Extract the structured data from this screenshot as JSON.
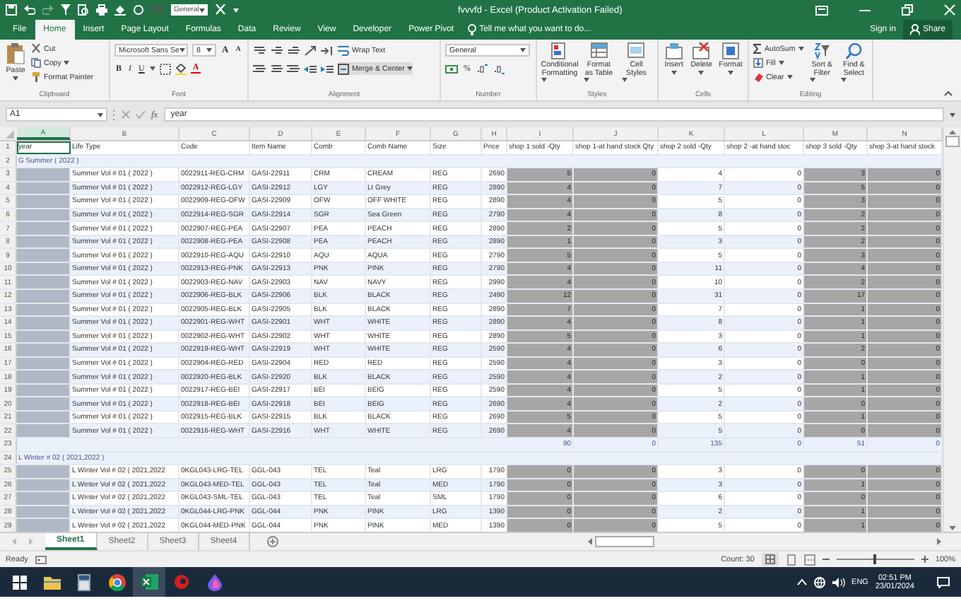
{
  "titlebar": {
    "quick_format": "General",
    "title": "fvvvfd - Excel (Product Activation Failed)"
  },
  "tabs": [
    {
      "label": "File",
      "selected": false
    },
    {
      "label": "Home",
      "selected": true
    },
    {
      "label": "Insert",
      "selected": false
    },
    {
      "label": "Page Layout",
      "selected": false
    },
    {
      "label": "Formulas",
      "selected": false
    },
    {
      "label": "Data",
      "selected": false
    },
    {
      "label": "Review",
      "selected": false
    },
    {
      "label": "View",
      "selected": false
    },
    {
      "label": "Developer",
      "selected": false
    },
    {
      "label": "Power Pivot",
      "selected": false
    }
  ],
  "tell_me": "Tell me what you want to do...",
  "sign_in": "Sign in",
  "share": "Share",
  "ribbon": {
    "clipboard": {
      "paste": "Paste",
      "cut": "Cut",
      "copy": "Copy",
      "format_painter": "Format Painter",
      "label": "Clipboard"
    },
    "font": {
      "family": "Microsoft Sans Se",
      "size": "8",
      "grow": "A",
      "shrink": "A",
      "bold": "B",
      "italic": "I",
      "underline": "U",
      "font_color": "A",
      "label": "Font"
    },
    "alignment": {
      "wrap_text": "Wrap Text",
      "merge_center": "Merge & Center",
      "label": "Alignment"
    },
    "number": {
      "format": "General",
      "percent": "%",
      "label": "Number"
    },
    "styles": {
      "buttons": [
        "Conditional Formatting",
        "Format as Table",
        "Cell Styles"
      ],
      "label": "Styles"
    },
    "cells": {
      "buttons": [
        "Insert",
        "Delete",
        "Format"
      ],
      "label": "Cells"
    },
    "editing": {
      "autosum": "AutoSum",
      "fill": "Fill",
      "clear": "Clear",
      "sort": "Sort & Filter",
      "find": "Find & Select",
      "label": "Editing"
    }
  },
  "formula_bar": {
    "name_box": "A1",
    "fx": "fx",
    "content": "year"
  },
  "sheet": {
    "columns": [
      {
        "letter": "A",
        "selected": true,
        "shaded": false
      },
      {
        "letter": "B",
        "selected": false,
        "shaded": false
      },
      {
        "letter": "C",
        "selected": false,
        "shaded": false
      },
      {
        "letter": "D",
        "selected": false,
        "shaded": false
      },
      {
        "letter": "E",
        "selected": false,
        "shaded": false
      },
      {
        "letter": "F",
        "selected": false,
        "shaded": false
      },
      {
        "letter": "G",
        "selected": false,
        "shaded": false
      },
      {
        "letter": "H",
        "selected": false,
        "shaded": false
      },
      {
        "letter": "I",
        "selected": false,
        "shaded": true
      },
      {
        "letter": "J",
        "selected": false,
        "shaded": true
      },
      {
        "letter": "K",
        "selected": false,
        "shaded": false
      },
      {
        "letter": "L",
        "selected": false,
        "shaded": false
      },
      {
        "letter": "M",
        "selected": false,
        "shaded": true
      },
      {
        "letter": "N",
        "selected": false,
        "shaded": true
      }
    ],
    "rows": [
      {
        "number": "1",
        "kind": "header",
        "cells": [
          "year",
          "Life Type",
          "Code",
          "Item Name",
          "Comb",
          "Comb Name",
          "Size",
          "Price",
          "shop 1 sold -Qty",
          "shop 1-at hand stock Qty",
          "shop 2 sold -Qty",
          "shop 2 -at hand stoc",
          "shop 3 sold -Qty",
          "shop 3-at hand stock"
        ]
      },
      {
        "number": "2",
        "kind": "group",
        "title": "G Summer ( 2022 )"
      },
      {
        "number": "3",
        "kind": "data",
        "cells": [
          "Summer Vol # 01 ( 2022 )",
          "0022911-REG-CRM",
          "GASI-22911",
          "CRM",
          "CREAM",
          "REG",
          "2690",
          "5",
          "0",
          "4",
          "0",
          "3",
          "0"
        ]
      },
      {
        "number": "4",
        "kind": "data",
        "cells": [
          "Summer Vol # 01 ( 2022 )",
          "0022912-REG-LGY",
          "GASI-22912",
          "LGY",
          "Lt Grey",
          "REG",
          "2890",
          "4",
          "0",
          "7",
          "0",
          "5",
          "0"
        ]
      },
      {
        "number": "5",
        "kind": "data",
        "cells": [
          "Summer Vol # 01 ( 2022 )",
          "0022909-REG-OFW",
          "GASI-22909",
          "OFW",
          "OFF WHITE",
          "REG",
          "2890",
          "4",
          "0",
          "5",
          "0",
          "3",
          "0"
        ]
      },
      {
        "number": "6",
        "kind": "data",
        "cells": [
          "Summer Vol # 01 ( 2022 )",
          "0022914-REG-SGR",
          "GASI-22914",
          "SGR",
          "Sea Green",
          "REG",
          "2790",
          "4",
          "0",
          "8",
          "0",
          "2",
          "0"
        ]
      },
      {
        "number": "7",
        "kind": "data",
        "cells": [
          "Summer Vol # 01 ( 2022 )",
          "0022907-REG-PEA",
          "GASI-22907",
          "PEA",
          "PEACH",
          "REG",
          "2890",
          "2",
          "0",
          "5",
          "0",
          "2",
          "0"
        ]
      },
      {
        "number": "8",
        "kind": "data",
        "cells": [
          "Summer Vol # 01 ( 2022 )",
          "0022908-REG-PEA",
          "GASI-22908",
          "PEA",
          "PEACH",
          "REG",
          "2890",
          "1",
          "0",
          "3",
          "0",
          "2",
          "0"
        ]
      },
      {
        "number": "9",
        "kind": "data",
        "cells": [
          "Summer Vol # 01 ( 2022 )",
          "0022910-REG-AQU",
          "GASI-22910",
          "AQU",
          "AQUA",
          "REG",
          "2790",
          "5",
          "0",
          "5",
          "0",
          "3",
          "0"
        ]
      },
      {
        "number": "10",
        "kind": "data",
        "cells": [
          "Summer Vol # 01 ( 2022 )",
          "0022913-REG-PNK",
          "GASI-22913",
          "PNK",
          "PINK",
          "REG",
          "2790",
          "4",
          "0",
          "11",
          "0",
          "4",
          "0"
        ]
      },
      {
        "number": "11",
        "kind": "data",
        "cells": [
          "Summer Vol # 01 ( 2022 )",
          "0022903-REG-NAV",
          "GASI-22903",
          "NAV",
          "NAVY",
          "REG",
          "2990",
          "4",
          "0",
          "10",
          "0",
          "2",
          "0"
        ]
      },
      {
        "number": "12",
        "kind": "data",
        "cells": [
          "Summer Vol # 01 ( 2022 )",
          "0022906-REG-BLK",
          "GASI-22906",
          "BLK",
          "BLACK",
          "REG",
          "2490",
          "12",
          "0",
          "31",
          "0",
          "17",
          "0"
        ]
      },
      {
        "number": "13",
        "kind": "data",
        "cells": [
          "Summer Vol # 01 ( 2022 )",
          "0022905-REG-BLK",
          "GASI-22905",
          "BLK",
          "BLACK",
          "REG",
          "2890",
          "7",
          "0",
          "7",
          "0",
          "1",
          "0"
        ]
      },
      {
        "number": "14",
        "kind": "data",
        "cells": [
          "Summer Vol # 01 ( 2022 )",
          "0022901-REG-WHT",
          "GASI-22901",
          "WHT",
          "WHITE",
          "REG",
          "2890",
          "4",
          "0",
          "8",
          "0",
          "1",
          "0"
        ]
      },
      {
        "number": "15",
        "kind": "data",
        "cells": [
          "Summer Vol # 01 ( 2022 )",
          "0022902-REG-WHT",
          "GASI-22902",
          "WHT",
          "WHITE",
          "REG",
          "2890",
          "5",
          "0",
          "3",
          "0",
          "1",
          "0"
        ]
      },
      {
        "number": "16",
        "kind": "data",
        "cells": [
          "Summer Vol # 01 ( 2022 )",
          "0022919-REG-WHT",
          "GASI-22919",
          "WHT",
          "WHITE",
          "REG",
          "2590",
          "4",
          "0",
          "6",
          "0",
          "2",
          "0"
        ]
      },
      {
        "number": "17",
        "kind": "data",
        "cells": [
          "Summer Vol # 01 ( 2022 )",
          "0022904-REG-RED",
          "GASI-22904",
          "RED",
          "RED",
          "REG",
          "2590",
          "4",
          "0",
          "3",
          "0",
          "0",
          "0"
        ]
      },
      {
        "number": "18",
        "kind": "data",
        "cells": [
          "Summer Vol # 01 ( 2022 )",
          "0022920-REG-BLK",
          "GASI-22920",
          "BLK",
          "BLACK",
          "REG",
          "2590",
          "4",
          "0",
          "2",
          "0",
          "1",
          "0"
        ]
      },
      {
        "number": "19",
        "kind": "data",
        "cells": [
          "Summer Vol # 01 ( 2022 )",
          "0022917-REG-BEI",
          "GASI-22917",
          "BEI",
          "BEIG",
          "REG",
          "2590",
          "4",
          "0",
          "5",
          "0",
          "1",
          "0"
        ]
      },
      {
        "number": "20",
        "kind": "data",
        "cells": [
          "Summer Vol # 01 ( 2022 )",
          "0022918-REG-BEI",
          "GASI-22918",
          "BEI",
          "BEIG",
          "REG",
          "2690",
          "4",
          "0",
          "2",
          "0",
          "0",
          "0"
        ]
      },
      {
        "number": "21",
        "kind": "data",
        "cells": [
          "Summer Vol # 01 ( 2022 )",
          "0022915-REG-BLK",
          "GASI-22915",
          "BLK",
          "BLACK",
          "REG",
          "2690",
          "5",
          "0",
          "5",
          "0",
          "1",
          "0"
        ]
      },
      {
        "number": "22",
        "kind": "data",
        "cells": [
          "Summer Vol # 01 ( 2022 )",
          "0022916-REG-WHT",
          "GASI-22916",
          "WHT",
          "WHITE",
          "REG",
          "2690",
          "4",
          "0",
          "5",
          "0",
          "0",
          "0"
        ]
      },
      {
        "number": "23",
        "kind": "total",
        "totals": [
          "90",
          "0",
          "135",
          "0",
          "51",
          "0"
        ]
      },
      {
        "number": "24",
        "kind": "group",
        "title": "L Winter # 02 ( 2021,2022 )"
      },
      {
        "number": "25",
        "kind": "data",
        "cells": [
          "L Winter Vol # 02 ( 2021,2022",
          "0KGL043-LRG-TEL",
          "GGL-043",
          "TEL",
          "Teal",
          "LRG",
          "1790",
          "0",
          "0",
          "3",
          "0",
          "0",
          "0"
        ]
      },
      {
        "number": "26",
        "kind": "data",
        "cells": [
          "L Winter Vol # 02 ( 2021,2022",
          "0KGL043-MED-TEL",
          "GGL-043",
          "TEL",
          "Teal",
          "MED",
          "1790",
          "0",
          "0",
          "3",
          "0",
          "1",
          "0"
        ]
      },
      {
        "number": "27",
        "kind": "data",
        "cells": [
          "L Winter Vol # 02 ( 2021,2022",
          "0KGL043-SML-TEL",
          "GGL-043",
          "TEL",
          "Teal",
          "SML",
          "1790",
          "0",
          "0",
          "6",
          "0",
          "0",
          "0"
        ]
      },
      {
        "number": "28",
        "kind": "data",
        "cells": [
          "L Winter Vol # 02 ( 2021,2022",
          "0KGL044-LRG-PNK",
          "GGL-044",
          "PNK",
          "PINK",
          "LRG",
          "1390",
          "0",
          "0",
          "2",
          "0",
          "1",
          "0"
        ]
      },
      {
        "number": "29",
        "kind": "data",
        "cells": [
          "L Winter Vol # 02 ( 2021,2022",
          "0KGL044-MED-PNK",
          "GGL-044",
          "PNK",
          "PINK",
          "MED",
          "1390",
          "0",
          "0",
          "5",
          "0",
          "1",
          "0"
        ]
      }
    ]
  },
  "sheet_tabs": [
    {
      "label": "Sheet1",
      "selected": true
    },
    {
      "label": "Sheet2",
      "selected": false
    },
    {
      "label": "Sheet3",
      "selected": false
    },
    {
      "label": "Sheet4",
      "selected": false
    }
  ],
  "status_bar": {
    "mode": "Ready",
    "count": "Count: 30",
    "zoom_slider": {
      "level": 0.5
    },
    "zoom": "100%"
  },
  "taskbar": {
    "language": "ENG",
    "time": "02:51 PM",
    "date": "23/01/2024"
  }
}
